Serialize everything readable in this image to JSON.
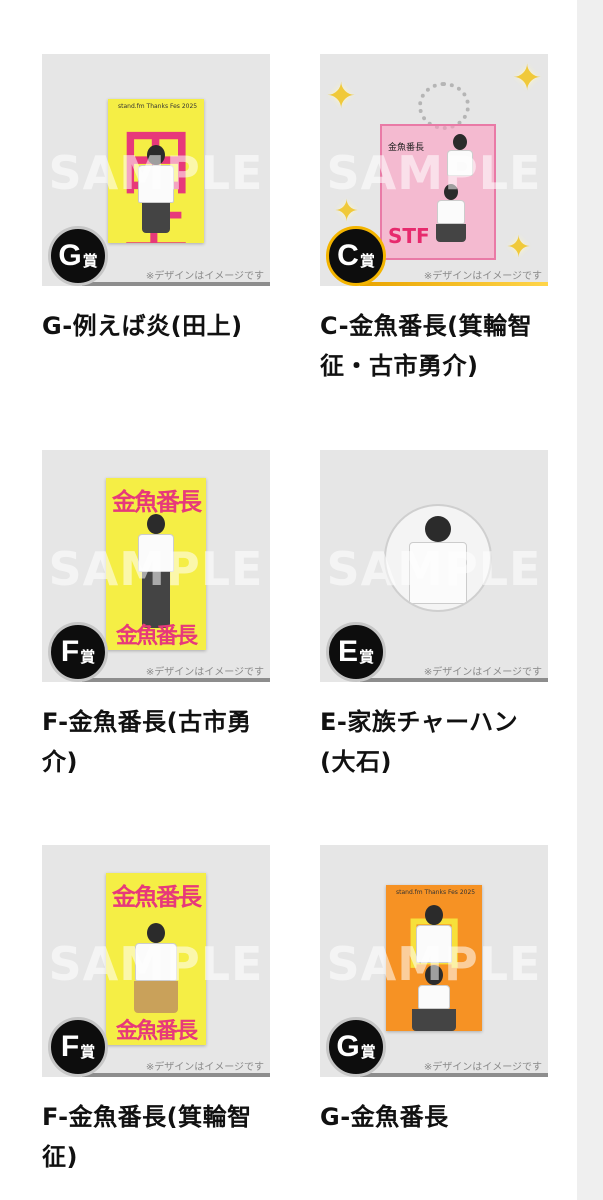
{
  "watermark": "SAMPLE",
  "note": "※デザインはイメージです",
  "prize_suffix": "賞",
  "products": [
    {
      "rank": "G",
      "title": "G-例えば炎(田上)"
    },
    {
      "rank": "C",
      "title": "C-金魚番長(箕輪智征・古市勇介)"
    },
    {
      "rank": "F",
      "title": "F-金魚番長(古市勇介)"
    },
    {
      "rank": "E",
      "title": "E-家族チャーハン(大石)"
    },
    {
      "rank": "F",
      "title": "F-金魚番長(箕輪智征)"
    },
    {
      "rank": "G",
      "title": "G-金魚番長"
    }
  ],
  "art": {
    "poster_header": "stand.fm Thanks Fes 2025",
    "big_char_1": "田",
    "big_char_2": "上",
    "kingyo": "金魚番長",
    "ste": "STF"
  },
  "colors": {
    "gold": "#f3b400",
    "poster_yellow": "#f5ee45",
    "poster_pink": "#e7397a"
  }
}
